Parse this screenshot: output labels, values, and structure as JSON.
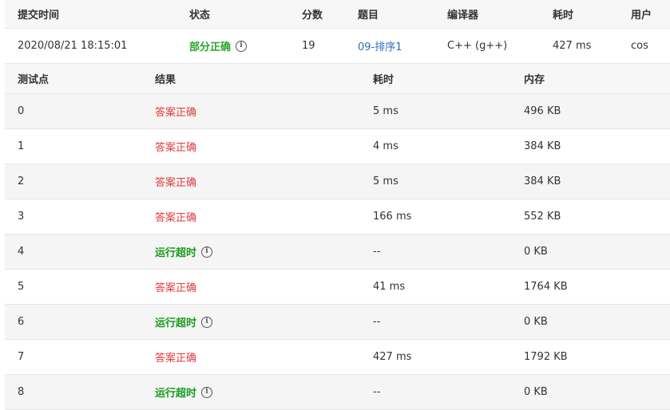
{
  "submission": {
    "headers": {
      "time": "提交时间",
      "status": "状态",
      "score": "分数",
      "problem": "题目",
      "compiler": "编译器",
      "duration": "耗时",
      "user": "用户"
    },
    "row": {
      "time": "2020/08/21 18:15:01",
      "status": "部分正确",
      "score": "19",
      "problem": "09-排序1",
      "compiler": "C++ (g++)",
      "duration": "427 ms",
      "user": "cos"
    }
  },
  "cases": {
    "headers": {
      "point": "测试点",
      "result": "结果",
      "time": "耗时",
      "memory": "内存"
    },
    "rows": [
      {
        "point": "0",
        "result": "答案正确",
        "time": "5 ms",
        "memory": "496 KB"
      },
      {
        "point": "1",
        "result": "答案正确",
        "time": "4 ms",
        "memory": "384 KB"
      },
      {
        "point": "2",
        "result": "答案正确",
        "time": "5 ms",
        "memory": "384 KB"
      },
      {
        "point": "3",
        "result": "答案正确",
        "time": "166 ms",
        "memory": "552 KB"
      },
      {
        "point": "4",
        "result": "运行超时",
        "time": "--",
        "memory": "0 KB"
      },
      {
        "point": "5",
        "result": "答案正确",
        "time": "41 ms",
        "memory": "1764 KB"
      },
      {
        "point": "6",
        "result": "运行超时",
        "time": "--",
        "memory": "0 KB"
      },
      {
        "point": "7",
        "result": "答案正确",
        "time": "427 ms",
        "memory": "1792 KB"
      },
      {
        "point": "8",
        "result": "运行超时",
        "time": "--",
        "memory": "0 KB"
      }
    ]
  },
  "colors": {
    "partial": "#2aa52e",
    "accepted": "#e2393c",
    "timeout": "#1a9a1f",
    "link": "#2a6fb5"
  },
  "icons": {
    "info": "info-circle-icon",
    "info_glyph": "i"
  }
}
